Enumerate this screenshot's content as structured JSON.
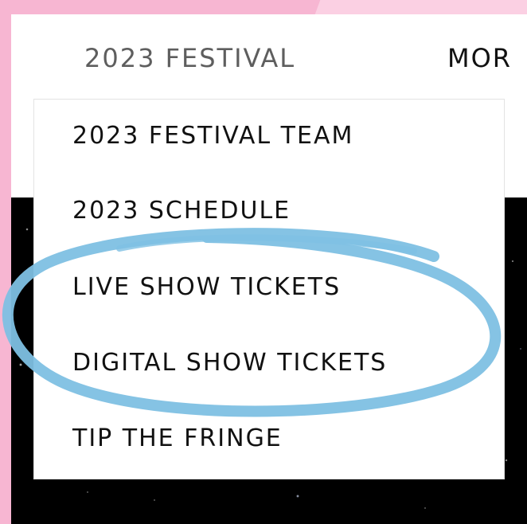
{
  "nav": {
    "festival_label": "2023 FESTIVAL",
    "more_label": "MOR"
  },
  "dropdown": {
    "items": [
      {
        "label": "2023 FESTIVAL TEAM"
      },
      {
        "label": "2023 SCHEDULE"
      },
      {
        "label": "LIVE SHOW TICKETS"
      },
      {
        "label": "DIGITAL SHOW TICKETS"
      },
      {
        "label": "TIP THE FRINGE"
      }
    ]
  },
  "colors": {
    "background_pink": "#f7b6d2",
    "highlight_circle": "#7ec0e3",
    "starfield": "#000000"
  }
}
